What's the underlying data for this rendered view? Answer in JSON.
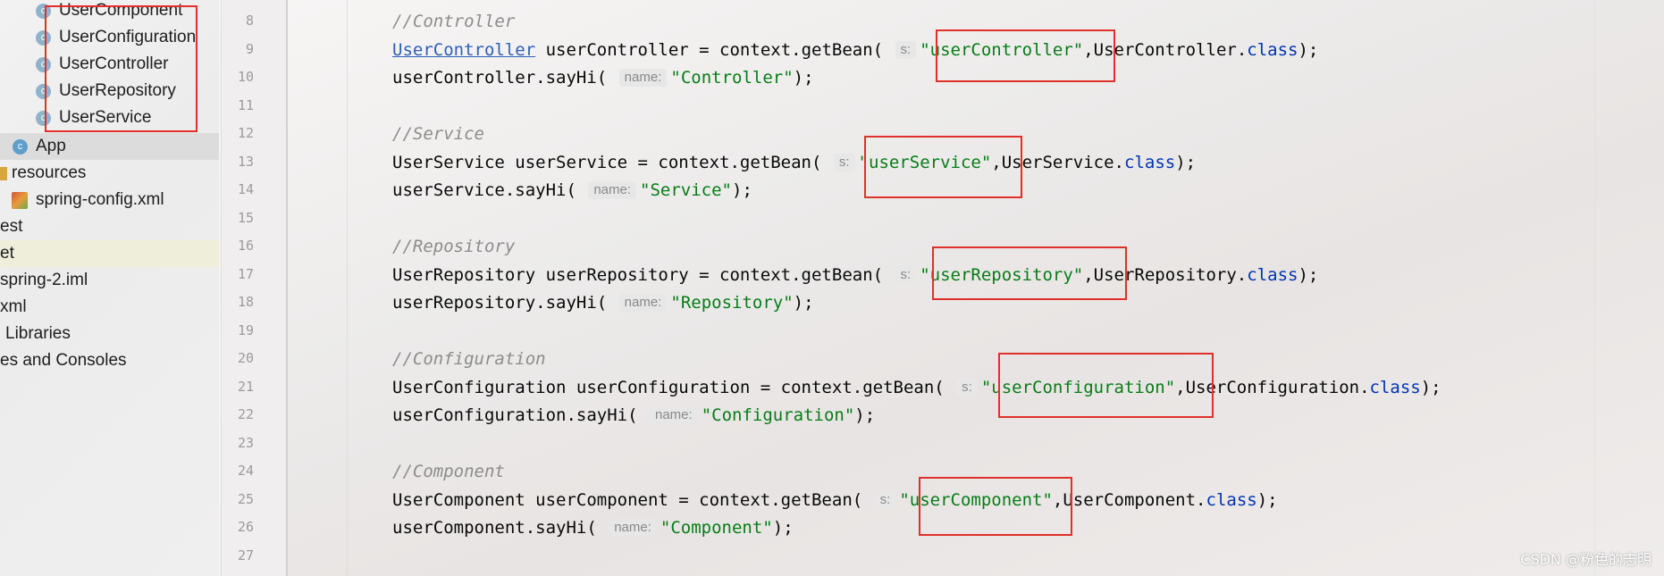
{
  "project_tree": {
    "items": [
      {
        "label": "UserComponent",
        "icon": "class-icon"
      },
      {
        "label": "UserConfiguration",
        "icon": "class-icon"
      },
      {
        "label": "UserController",
        "icon": "class-icon"
      },
      {
        "label": "UserRepository",
        "icon": "class-icon"
      },
      {
        "label": "UserService",
        "icon": "class-icon"
      },
      {
        "label": "App",
        "icon": "app-class-icon"
      },
      {
        "label": "resources",
        "icon": "resources-folder-icon"
      },
      {
        "label": "spring-config.xml",
        "icon": "xml-file-icon"
      },
      {
        "label": "est"
      },
      {
        "label": "et"
      },
      {
        "label": "spring-2.iml"
      },
      {
        "label": "xml"
      },
      {
        "label": "Libraries"
      },
      {
        "label": "es and Consoles"
      }
    ]
  },
  "gutter": {
    "line_numbers": [
      "8",
      "9",
      "10",
      "11",
      "12",
      "13",
      "14",
      "15",
      "16",
      "17",
      "18",
      "19",
      "20",
      "21",
      "22",
      "23",
      "24",
      "25",
      "26",
      "27"
    ]
  },
  "code": {
    "comments": {
      "controller": "//Controller",
      "service": "//Service",
      "repository": "//Repository",
      "configuration": "//Configuration",
      "component": "//Component"
    },
    "param_hints": {
      "s": "s:",
      "name": "name:"
    },
    "class_kw": "class",
    "controller": {
      "type": "UserController",
      "decl": " userController = context.getBean( ",
      "bean": "\"userController\"",
      "tail_cls": ",UserController.",
      "call": "userController.sayHi( ",
      "arg": "\"Controller\""
    },
    "service": {
      "decl": "UserService userService = context.getBean( ",
      "bean": "\"userService\"",
      "tail_cls": ",UserService.",
      "call": "userService.sayHi( ",
      "arg": "\"Service\""
    },
    "repository": {
      "decl": "UserRepository userRepository = context.getBean( ",
      "bean": "\"userRepository\"",
      "tail_cls": ",UserRepository.",
      "call": "userRepository.sayHi( ",
      "arg": "\"Repository\""
    },
    "configuration": {
      "decl": "UserConfiguration userConfiguration = context.getBean( ",
      "bean": "\"userConfiguration\"",
      "tail_cls": ",UserConfiguration.",
      "call": "userConfiguration.sayHi( ",
      "arg": "\"Configuration\""
    },
    "component": {
      "decl": "UserComponent userComponent = context.getBean( ",
      "bean": "\"userComponent\"",
      "tail_cls": ",UserComponent.",
      "call": "userComponent.sayHi( ",
      "arg": "\"Component\""
    },
    "close_stmt": ");"
  },
  "watermark": "CSDN @粉色的志明",
  "colors": {
    "annotation_red": "#e0302a",
    "string_green": "#067d17",
    "keyword_blue": "#0033b3",
    "comment_gray": "#8c8c8c"
  }
}
